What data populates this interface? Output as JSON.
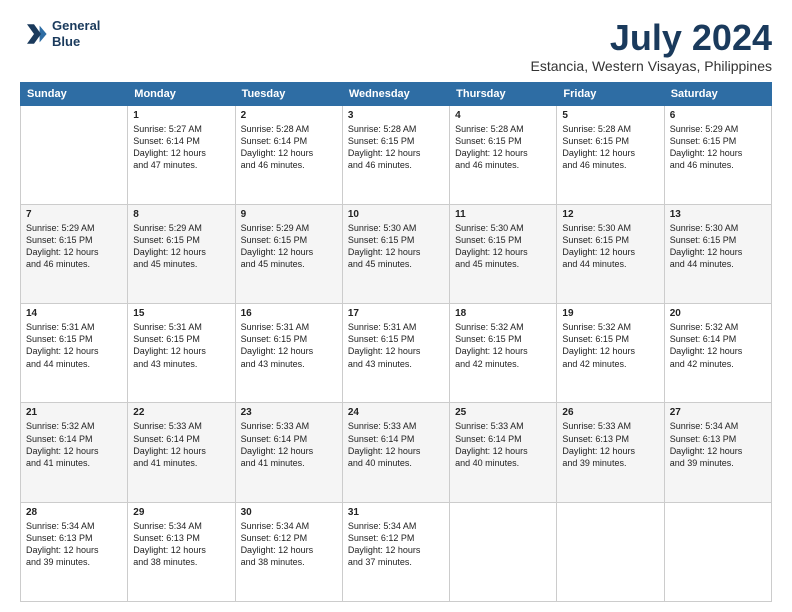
{
  "header": {
    "logo_line1": "General",
    "logo_line2": "Blue",
    "month_title": "July 2024",
    "location": "Estancia, Western Visayas, Philippines"
  },
  "weekdays": [
    "Sunday",
    "Monday",
    "Tuesday",
    "Wednesday",
    "Thursday",
    "Friday",
    "Saturday"
  ],
  "weeks": [
    [
      {
        "day": "",
        "info": ""
      },
      {
        "day": "1",
        "info": "Sunrise: 5:27 AM\nSunset: 6:14 PM\nDaylight: 12 hours\nand 47 minutes."
      },
      {
        "day": "2",
        "info": "Sunrise: 5:28 AM\nSunset: 6:14 PM\nDaylight: 12 hours\nand 46 minutes."
      },
      {
        "day": "3",
        "info": "Sunrise: 5:28 AM\nSunset: 6:15 PM\nDaylight: 12 hours\nand 46 minutes."
      },
      {
        "day": "4",
        "info": "Sunrise: 5:28 AM\nSunset: 6:15 PM\nDaylight: 12 hours\nand 46 minutes."
      },
      {
        "day": "5",
        "info": "Sunrise: 5:28 AM\nSunset: 6:15 PM\nDaylight: 12 hours\nand 46 minutes."
      },
      {
        "day": "6",
        "info": "Sunrise: 5:29 AM\nSunset: 6:15 PM\nDaylight: 12 hours\nand 46 minutes."
      }
    ],
    [
      {
        "day": "7",
        "info": "Sunrise: 5:29 AM\nSunset: 6:15 PM\nDaylight: 12 hours\nand 46 minutes."
      },
      {
        "day": "8",
        "info": "Sunrise: 5:29 AM\nSunset: 6:15 PM\nDaylight: 12 hours\nand 45 minutes."
      },
      {
        "day": "9",
        "info": "Sunrise: 5:29 AM\nSunset: 6:15 PM\nDaylight: 12 hours\nand 45 minutes."
      },
      {
        "day": "10",
        "info": "Sunrise: 5:30 AM\nSunset: 6:15 PM\nDaylight: 12 hours\nand 45 minutes."
      },
      {
        "day": "11",
        "info": "Sunrise: 5:30 AM\nSunset: 6:15 PM\nDaylight: 12 hours\nand 45 minutes."
      },
      {
        "day": "12",
        "info": "Sunrise: 5:30 AM\nSunset: 6:15 PM\nDaylight: 12 hours\nand 44 minutes."
      },
      {
        "day": "13",
        "info": "Sunrise: 5:30 AM\nSunset: 6:15 PM\nDaylight: 12 hours\nand 44 minutes."
      }
    ],
    [
      {
        "day": "14",
        "info": "Sunrise: 5:31 AM\nSunset: 6:15 PM\nDaylight: 12 hours\nand 44 minutes."
      },
      {
        "day": "15",
        "info": "Sunrise: 5:31 AM\nSunset: 6:15 PM\nDaylight: 12 hours\nand 43 minutes."
      },
      {
        "day": "16",
        "info": "Sunrise: 5:31 AM\nSunset: 6:15 PM\nDaylight: 12 hours\nand 43 minutes."
      },
      {
        "day": "17",
        "info": "Sunrise: 5:31 AM\nSunset: 6:15 PM\nDaylight: 12 hours\nand 43 minutes."
      },
      {
        "day": "18",
        "info": "Sunrise: 5:32 AM\nSunset: 6:15 PM\nDaylight: 12 hours\nand 42 minutes."
      },
      {
        "day": "19",
        "info": "Sunrise: 5:32 AM\nSunset: 6:15 PM\nDaylight: 12 hours\nand 42 minutes."
      },
      {
        "day": "20",
        "info": "Sunrise: 5:32 AM\nSunset: 6:14 PM\nDaylight: 12 hours\nand 42 minutes."
      }
    ],
    [
      {
        "day": "21",
        "info": "Sunrise: 5:32 AM\nSunset: 6:14 PM\nDaylight: 12 hours\nand 41 minutes."
      },
      {
        "day": "22",
        "info": "Sunrise: 5:33 AM\nSunset: 6:14 PM\nDaylight: 12 hours\nand 41 minutes."
      },
      {
        "day": "23",
        "info": "Sunrise: 5:33 AM\nSunset: 6:14 PM\nDaylight: 12 hours\nand 41 minutes."
      },
      {
        "day": "24",
        "info": "Sunrise: 5:33 AM\nSunset: 6:14 PM\nDaylight: 12 hours\nand 40 minutes."
      },
      {
        "day": "25",
        "info": "Sunrise: 5:33 AM\nSunset: 6:14 PM\nDaylight: 12 hours\nand 40 minutes."
      },
      {
        "day": "26",
        "info": "Sunrise: 5:33 AM\nSunset: 6:13 PM\nDaylight: 12 hours\nand 39 minutes."
      },
      {
        "day": "27",
        "info": "Sunrise: 5:34 AM\nSunset: 6:13 PM\nDaylight: 12 hours\nand 39 minutes."
      }
    ],
    [
      {
        "day": "28",
        "info": "Sunrise: 5:34 AM\nSunset: 6:13 PM\nDaylight: 12 hours\nand 39 minutes."
      },
      {
        "day": "29",
        "info": "Sunrise: 5:34 AM\nSunset: 6:13 PM\nDaylight: 12 hours\nand 38 minutes."
      },
      {
        "day": "30",
        "info": "Sunrise: 5:34 AM\nSunset: 6:12 PM\nDaylight: 12 hours\nand 38 minutes."
      },
      {
        "day": "31",
        "info": "Sunrise: 5:34 AM\nSunset: 6:12 PM\nDaylight: 12 hours\nand 37 minutes."
      },
      {
        "day": "",
        "info": ""
      },
      {
        "day": "",
        "info": ""
      },
      {
        "day": "",
        "info": ""
      }
    ]
  ]
}
